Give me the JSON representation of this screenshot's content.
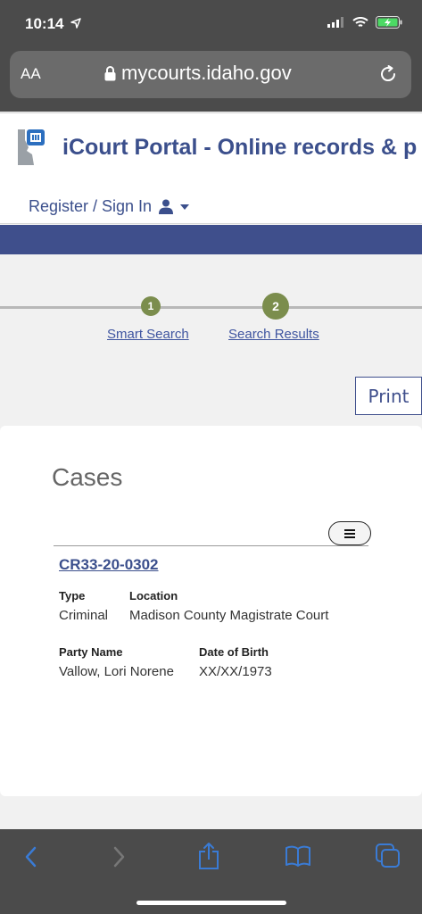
{
  "status_bar": {
    "time": "10:14"
  },
  "browser": {
    "text_size_label": "AA",
    "url": "mycourts.idaho.gov"
  },
  "header": {
    "site_title": "iCourt Portal - Online records & p",
    "signin_label": "Register / Sign In"
  },
  "steps": [
    {
      "number": "1",
      "label": "Smart Search"
    },
    {
      "number": "2",
      "label": "Search Results"
    }
  ],
  "print_label": "Print",
  "cases": {
    "title": "Cases",
    "case_number": "CR33-20-0302",
    "type_label": "Type",
    "type_value": "Criminal",
    "location_label": "Location",
    "location_value": "Madison County Magistrate Court",
    "party_label": "Party Name",
    "party_value": "Vallow, Lori Norene",
    "dob_label": "Date of Birth",
    "dob_value": "XX/XX/1973"
  },
  "colors": {
    "brand_blue": "#3f4f8c",
    "step_green": "#7b8d4d",
    "toolbar_blue": "#3a7bd5"
  },
  "icons": [
    "location-arrow-icon",
    "cellular-signal-icon",
    "wifi-icon",
    "battery-charging-icon",
    "lock-icon",
    "reload-icon",
    "idaho-logo-icon",
    "user-icon",
    "caret-down-icon",
    "hamburger-menu-icon",
    "back-icon",
    "forward-icon",
    "share-icon",
    "bookmarks-icon",
    "tabs-icon"
  ]
}
